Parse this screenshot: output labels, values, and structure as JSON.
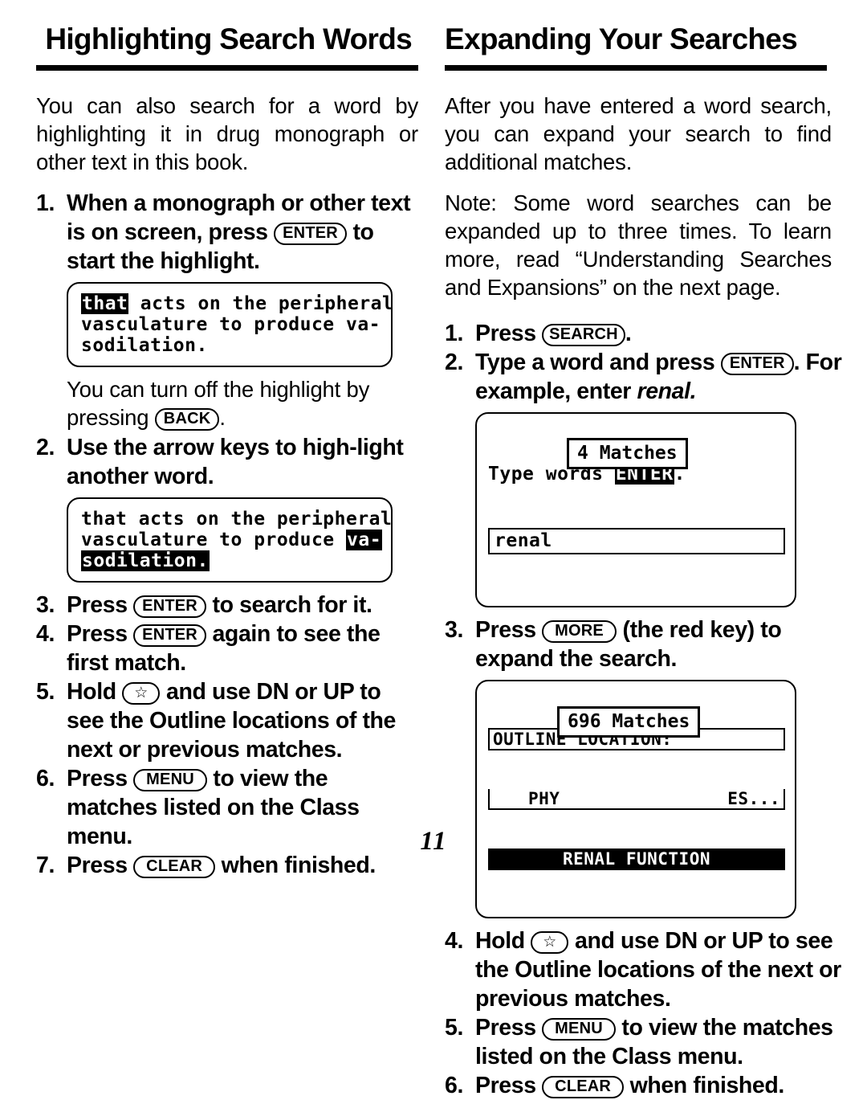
{
  "page": {
    "number": "11"
  },
  "left": {
    "heading": "Highlighting Search Words",
    "intro": "You can also search for a word by highlighting it in drug monograph or other text in this book.",
    "steps": [
      {
        "num": "1.",
        "parts": [
          {
            "t": "text",
            "v": "When a monograph or other text is on screen, press "
          },
          {
            "t": "key",
            "v": "ENTER"
          },
          {
            "t": "text",
            "v": " to start the highlight."
          }
        ]
      },
      {
        "num": "2.",
        "parts": [
          {
            "t": "text",
            "v": "Use the arrow keys to high-light another word."
          }
        ]
      },
      {
        "num": "3.",
        "parts": [
          {
            "t": "text",
            "v": "Press "
          },
          {
            "t": "key",
            "v": "ENTER"
          },
          {
            "t": "text",
            "v": " to search for it."
          }
        ]
      },
      {
        "num": "4.",
        "parts": [
          {
            "t": "text",
            "v": "Press "
          },
          {
            "t": "key",
            "v": "ENTER"
          },
          {
            "t": "text",
            "v": " again to see the first match."
          }
        ]
      },
      {
        "num": "5.",
        "parts": [
          {
            "t": "text",
            "v": "Hold "
          },
          {
            "t": "key",
            "v": "☆"
          },
          {
            "t": "text",
            "v": " and use DN or UP to see the Outline locations of the next or previous matches."
          }
        ]
      },
      {
        "num": "6.",
        "parts": [
          {
            "t": "text",
            "v": "Press "
          },
          {
            "t": "key",
            "v": "MENU"
          },
          {
            "t": "text",
            "v": " to view the matches listed on the Class menu."
          }
        ]
      },
      {
        "num": "7.",
        "parts": [
          {
            "t": "text",
            "v": "Press "
          },
          {
            "t": "key",
            "v": "CLEAR"
          },
          {
            "t": "text",
            "v": " when finished."
          }
        ]
      }
    ],
    "note_after_step1": {
      "text_before": "You can turn off the highlight by pressing ",
      "key": "BACK",
      "text_after": "."
    },
    "lcd1": {
      "line1_highlight": "that",
      "line1_rest": " acts on the peripheral",
      "line2": "vasculature to produce va-",
      "line3": "sodilation."
    },
    "lcd2": {
      "line1": "that acts on the peripheral",
      "line2_plain": "vasculature to produce ",
      "line2_highlight": "va-",
      "line3_highlight": "sodilation."
    }
  },
  "right": {
    "heading": "Expanding Your Searches",
    "intro": "After you have entered a word search, you can expand your search to find additional matches.",
    "note": "Note: Some word searches can be expanded up to three times. To learn more, read “Understanding Searches and Expansions” on the next page.",
    "steps": [
      {
        "num": "1.",
        "parts": [
          {
            "t": "text",
            "v": "Press "
          },
          {
            "t": "key",
            "v": "SEARCH"
          },
          {
            "t": "text",
            "v": "."
          }
        ]
      },
      {
        "num": "2.",
        "parts": [
          {
            "t": "text",
            "v": "Type a word and press "
          },
          {
            "t": "key",
            "v": "ENTER"
          },
          {
            "t": "text",
            "v": ". For example, enter "
          },
          {
            "t": "ital",
            "v": "renal."
          }
        ]
      },
      {
        "num": "3.",
        "parts": [
          {
            "t": "text",
            "v": "Press "
          },
          {
            "t": "key",
            "v": "MORE"
          },
          {
            "t": "text",
            "v": " (the red key) to expand the search."
          }
        ]
      },
      {
        "num": "4.",
        "parts": [
          {
            "t": "text",
            "v": "Hold "
          },
          {
            "t": "key",
            "v": "☆"
          },
          {
            "t": "text",
            "v": " and use DN or UP to see the Outline locations of the next or previous matches."
          }
        ]
      },
      {
        "num": "5.",
        "parts": [
          {
            "t": "text",
            "v": "Press "
          },
          {
            "t": "key",
            "v": "MENU"
          },
          {
            "t": "text",
            "v": " to view the matches listed on the Class menu."
          }
        ]
      },
      {
        "num": "6.",
        "parts": [
          {
            "t": "text",
            "v": "Press "
          },
          {
            "t": "key",
            "v": "CLEAR"
          },
          {
            "t": "text",
            "v": " when finished."
          }
        ]
      }
    ],
    "lcd1": {
      "prompt": "Type words ",
      "prompt_key": "ENTER",
      "prompt_end": ".",
      "field_value": "renal",
      "popup": "4 Matches"
    },
    "lcd2": {
      "title": "OUTLINE LOCATION:",
      "row1_left": "PHY",
      "row1_right": "ES...",
      "row2": "RENAL FUNCTION",
      "popup": "696 Matches"
    }
  }
}
